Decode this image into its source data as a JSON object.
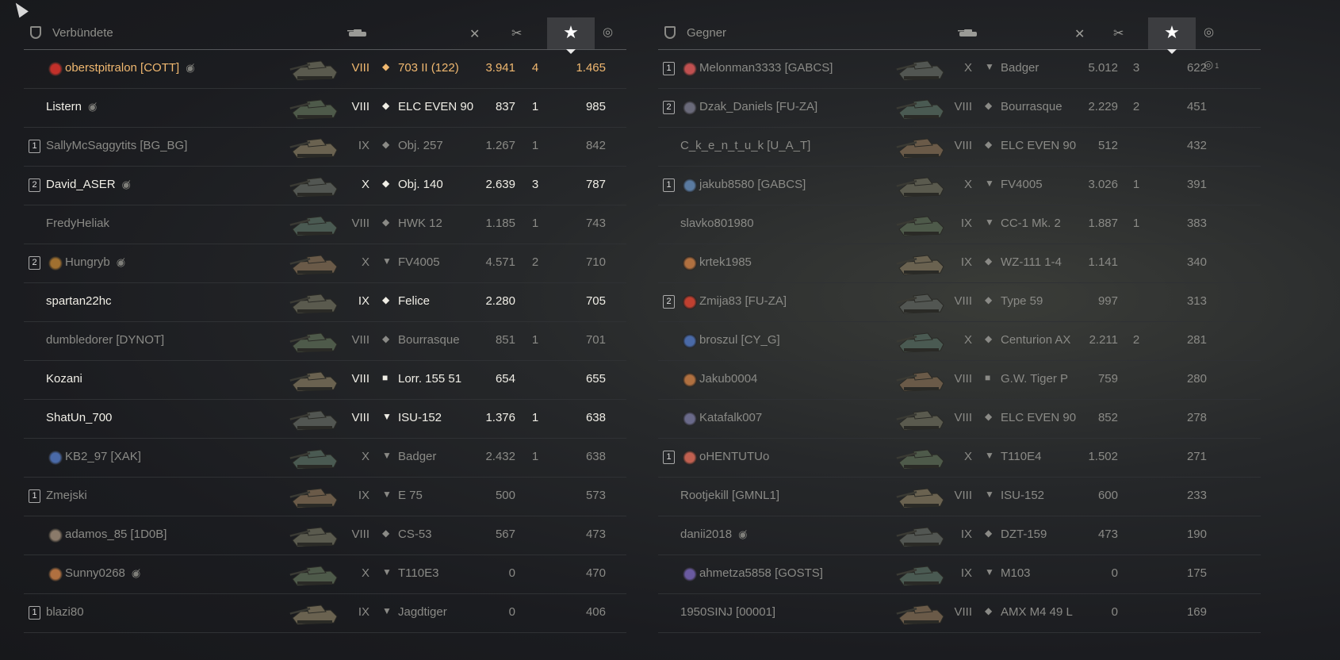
{
  "ally": {
    "header": {
      "title": "Verbündete"
    },
    "players": [
      {
        "platoon": "",
        "name": "oberstpitralon [COTT]",
        "anon": true,
        "tier": "VIII",
        "cls": "◆",
        "vehicle": "703 II (122)",
        "dmg": "3.941",
        "kills": "4",
        "xp": "1.465",
        "style": "self",
        "clan": "#c2302a"
      },
      {
        "platoon": "",
        "name": "Listern",
        "anon": true,
        "tier": "VIII",
        "cls": "◆",
        "vehicle": "ELC EVEN 90",
        "dmg": "837",
        "kills": "1",
        "xp": "985",
        "style": "bright",
        "clan": ""
      },
      {
        "platoon": "1",
        "name": "SallyMcSaggytits [BG_BG]",
        "anon": false,
        "tier": "IX",
        "cls": "◆",
        "vehicle": "Obj. 257",
        "dmg": "1.267",
        "kills": "1",
        "xp": "842",
        "style": "dim",
        "clan": ""
      },
      {
        "platoon": "2",
        "name": "David_ASER",
        "anon": true,
        "tier": "X",
        "cls": "◆",
        "vehicle": "Obj. 140",
        "dmg": "2.639",
        "kills": "3",
        "xp": "787",
        "style": "bright",
        "clan": ""
      },
      {
        "platoon": "",
        "name": "FredyHeliak",
        "anon": false,
        "tier": "VIII",
        "cls": "◆",
        "vehicle": "HWK 12",
        "dmg": "1.185",
        "kills": "1",
        "xp": "743",
        "style": "dim",
        "clan": ""
      },
      {
        "platoon": "2",
        "name": "Hungryb",
        "anon": true,
        "tier": "X",
        "cls": "▼",
        "vehicle": "FV4005",
        "dmg": "4.571",
        "kills": "2",
        "xp": "710",
        "style": "dim",
        "clan": "#a07030"
      },
      {
        "platoon": "",
        "name": "spartan22hc",
        "anon": false,
        "tier": "IX",
        "cls": "◆",
        "vehicle": "Felice",
        "dmg": "2.280",
        "kills": "",
        "xp": "705",
        "style": "bright",
        "clan": ""
      },
      {
        "platoon": "",
        "name": "dumbledorer [DYNOT]",
        "anon": false,
        "tier": "VIII",
        "cls": "◆",
        "vehicle": "Bourrasque",
        "dmg": "851",
        "kills": "1",
        "xp": "701",
        "style": "dim",
        "clan": ""
      },
      {
        "platoon": "",
        "name": "Kozani",
        "anon": false,
        "tier": "VIII",
        "cls": "■",
        "vehicle": "Lorr. 155 51",
        "dmg": "654",
        "kills": "",
        "xp": "655",
        "style": "bright",
        "clan": ""
      },
      {
        "platoon": "",
        "name": "ShatUn_700",
        "anon": false,
        "tier": "VIII",
        "cls": "▼",
        "vehicle": "ISU-152",
        "dmg": "1.376",
        "kills": "1",
        "xp": "638",
        "style": "bright",
        "clan": ""
      },
      {
        "platoon": "",
        "name": "KB2_97 [XAK]",
        "anon": false,
        "tier": "X",
        "cls": "▼",
        "vehicle": "Badger",
        "dmg": "2.432",
        "kills": "1",
        "xp": "638",
        "style": "dim",
        "clan": "#4a6aa8"
      },
      {
        "platoon": "1",
        "name": "Zmejski",
        "anon": false,
        "tier": "IX",
        "cls": "▼",
        "vehicle": "E 75",
        "dmg": "500",
        "kills": "",
        "xp": "573",
        "style": "dim",
        "clan": ""
      },
      {
        "platoon": "",
        "name": "adamos_85 [1D0B]",
        "anon": false,
        "tier": "VIII",
        "cls": "◆",
        "vehicle": "CS-53",
        "dmg": "567",
        "kills": "",
        "xp": "473",
        "style": "dim",
        "clan": "#8a7a6a"
      },
      {
        "platoon": "",
        "name": "Sunny0268",
        "anon": true,
        "tier": "X",
        "cls": "▼",
        "vehicle": "T110E3",
        "dmg": "0",
        "kills": "",
        "xp": "470",
        "style": "dim",
        "clan": "#b07040"
      },
      {
        "platoon": "1",
        "name": "blazi80",
        "anon": false,
        "tier": "IX",
        "cls": "▼",
        "vehicle": "Jagdtiger",
        "dmg": "0",
        "kills": "",
        "xp": "406",
        "style": "dim",
        "clan": ""
      }
    ]
  },
  "enemy": {
    "header": {
      "title": "Gegner"
    },
    "players": [
      {
        "platoon": "1",
        "name": "Melonman3333 [GABCS]",
        "anon": false,
        "tier": "X",
        "cls": "▼",
        "vehicle": "Badger",
        "dmg": "5.012",
        "kills": "3",
        "xp": "622",
        "style": "dim",
        "clan": "#c05050"
      },
      {
        "platoon": "2",
        "name": "Dzak_Daniels [FU-ZA]",
        "anon": false,
        "tier": "VIII",
        "cls": "◆",
        "vehicle": "Bourrasque",
        "dmg": "2.229",
        "kills": "2",
        "xp": "451",
        "style": "dim",
        "clan": "#6a6a7a"
      },
      {
        "platoon": "",
        "name": "C_k_e_n_t_u_k [U_A_T]",
        "anon": false,
        "tier": "VIII",
        "cls": "◆",
        "vehicle": "ELC EVEN 90",
        "dmg": "512",
        "kills": "",
        "xp": "432",
        "style": "dim",
        "clan": ""
      },
      {
        "platoon": "1",
        "name": "jakub8580 [GABCS]",
        "anon": false,
        "tier": "X",
        "cls": "▼",
        "vehicle": "FV4005",
        "dmg": "3.026",
        "kills": "1",
        "xp": "391",
        "style": "dim",
        "clan": "#5a7aa0"
      },
      {
        "platoon": "",
        "name": "slavko801980",
        "anon": false,
        "tier": "IX",
        "cls": "▼",
        "vehicle": "CC-1 Mk. 2",
        "dmg": "1.887",
        "kills": "1",
        "xp": "383",
        "style": "dim",
        "clan": ""
      },
      {
        "platoon": "",
        "name": "krtek1985",
        "anon": false,
        "tier": "IX",
        "cls": "◆",
        "vehicle": "WZ-111 1-4",
        "dmg": "1.141",
        "kills": "",
        "xp": "340",
        "style": "dim",
        "clan": "#b07040"
      },
      {
        "platoon": "2",
        "name": "Zmija83 [FU-ZA]",
        "anon": false,
        "tier": "VIII",
        "cls": "◆",
        "vehicle": "Type 59",
        "dmg": "997",
        "kills": "",
        "xp": "313",
        "style": "dim",
        "clan": "#c04030"
      },
      {
        "platoon": "",
        "name": "broszul [CY_G]",
        "anon": false,
        "tier": "X",
        "cls": "◆",
        "vehicle": "Centurion AX",
        "dmg": "2.211",
        "kills": "2",
        "xp": "281",
        "style": "dim",
        "clan": "#4a6aa8"
      },
      {
        "platoon": "",
        "name": "Jakub0004",
        "anon": false,
        "tier": "VIII",
        "cls": "■",
        "vehicle": "G.W. Tiger P",
        "dmg": "759",
        "kills": "",
        "xp": "280",
        "style": "dim",
        "clan": "#b07040"
      },
      {
        "platoon": "",
        "name": "Katafalk007",
        "anon": false,
        "tier": "VIII",
        "cls": "◆",
        "vehicle": "ELC EVEN 90",
        "dmg": "852",
        "kills": "",
        "xp": "278",
        "style": "dim",
        "clan": "#6a6a8a"
      },
      {
        "platoon": "1",
        "name": "oHENTUTUo",
        "anon": false,
        "tier": "X",
        "cls": "▼",
        "vehicle": "T110E4",
        "dmg": "1.502",
        "kills": "",
        "xp": "271",
        "style": "dim",
        "clan": "#c06050"
      },
      {
        "platoon": "",
        "name": "Rootjekill [GMNL1]",
        "anon": false,
        "tier": "VIII",
        "cls": "▼",
        "vehicle": "ISU-152",
        "dmg": "600",
        "kills": "",
        "xp": "233",
        "style": "dim",
        "clan": ""
      },
      {
        "platoon": "",
        "name": "danii2018",
        "anon": true,
        "tier": "IX",
        "cls": "◆",
        "vehicle": "DZT-159",
        "dmg": "473",
        "kills": "",
        "xp": "190",
        "style": "dim",
        "clan": ""
      },
      {
        "platoon": "",
        "name": "ahmetza5858 [GOSTS]",
        "anon": false,
        "tier": "IX",
        "cls": "▼",
        "vehicle": "M103",
        "dmg": "0",
        "kills": "",
        "xp": "175",
        "style": "dim",
        "clan": "#6a5aa0"
      },
      {
        "platoon": "",
        "name": "1950SINJ [00001]",
        "anon": false,
        "tier": "VIII",
        "cls": "◆",
        "vehicle": "AMX M4 49 L",
        "dmg": "0",
        "kills": "",
        "xp": "169",
        "style": "dim",
        "clan": ""
      }
    ],
    "medal_count": "1"
  }
}
